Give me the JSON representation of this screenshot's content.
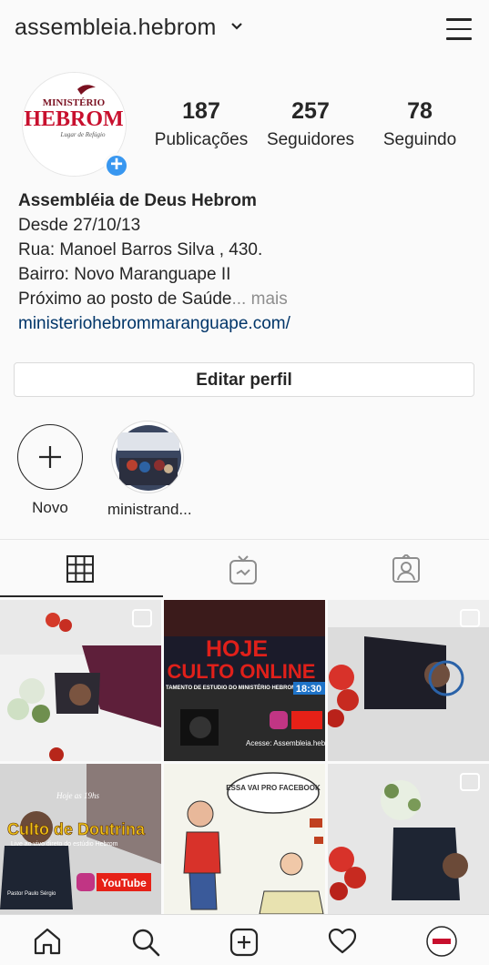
{
  "header": {
    "username": "assembleia.hebrom",
    "chevron_icon": "chevron-down-icon",
    "menu_icon": "menu-icon"
  },
  "profile": {
    "avatar_text_top": "MINISTÉRIO",
    "avatar_text_main": "HEBROM",
    "avatar_text_sub": "Lugar de Refúgio",
    "stats": [
      {
        "value": "187",
        "label": "Publicações"
      },
      {
        "value": "257",
        "label": "Seguidores"
      },
      {
        "value": "78",
        "label": "Seguindo"
      }
    ],
    "bio": {
      "name": "Assembléia de Deus Hebrom",
      "lines": [
        "Desde 27/10/13",
        "Rua: Manoel Barros Silva , 430.",
        "Bairro: Novo Maranguape II",
        "Próximo ao posto de Saúde"
      ],
      "more": "... mais",
      "link": "ministeriohebrommaranguape.com/"
    },
    "edit_button": "Editar perfil"
  },
  "highlights": [
    {
      "label": "Novo"
    },
    {
      "label": "ministrand..."
    }
  ],
  "grid_posts": [
    {
      "text": ""
    },
    {
      "line1": "HOJE",
      "line2": "CULTO ONLINE",
      "line3": "TAMENTO DE ESTUDIO DO MINISTÉRIO HEBROM",
      "time": "18:30",
      "footer": "Acesse: Assembleia.hebrom"
    },
    {
      "text": ""
    },
    {
      "top": "Hoje as 19hs",
      "title": "Culto de Doutrina",
      "sub": "Live ao vivo direto do estúdio Hebrom",
      "footer": "Pastor Paulo Sérgio",
      "yt": "YouTube"
    },
    {
      "bubble": "ESSA VAI PRO FACEBOOK"
    },
    {
      "text": ""
    }
  ],
  "colors": {
    "accent": "#3897f0",
    "link": "#003569",
    "brand_red": "#c8102e"
  }
}
